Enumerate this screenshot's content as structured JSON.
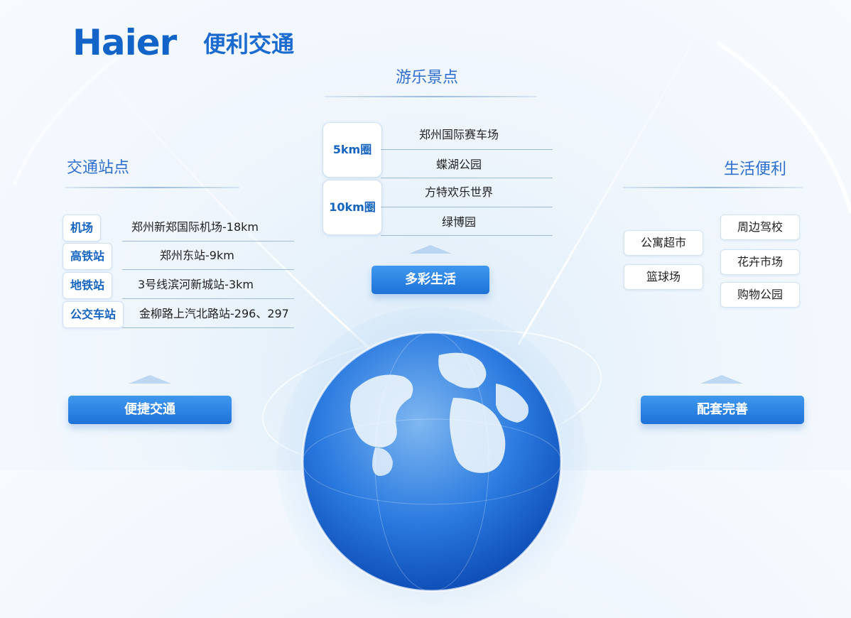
{
  "header": {
    "logo_text": "Haier",
    "title": "便利交通"
  },
  "transport": {
    "title": "交通站点",
    "rows": [
      {
        "label": "机场",
        "value": "郑州新郑国际机场-18km"
      },
      {
        "label": "高铁站",
        "value": "郑州东站-9km"
      },
      {
        "label": "地铁站",
        "value": "3号线滨河新城站-3km"
      },
      {
        "label": "公交车站",
        "value": "金柳路上汽北路站-296、297"
      }
    ],
    "button": "便捷交通"
  },
  "attractions": {
    "title": "游乐景点",
    "rings": [
      {
        "label": "5km圈",
        "items": [
          "郑州国际赛车场",
          "蝶湖公园"
        ]
      },
      {
        "label": "10km圈",
        "items": [
          "方特欢乐世界",
          "绿博园"
        ]
      }
    ],
    "button": "多彩生活"
  },
  "living": {
    "title": "生活便利",
    "left_items": [
      "公寓超市",
      "篮球场"
    ],
    "right_items": [
      "周边驾校",
      "花卉市场",
      "购物公园"
    ],
    "button": "配套完善"
  },
  "colors": {
    "brand": "#1264c8",
    "accent": "#2f6fcf",
    "button": "#1e72d8"
  }
}
